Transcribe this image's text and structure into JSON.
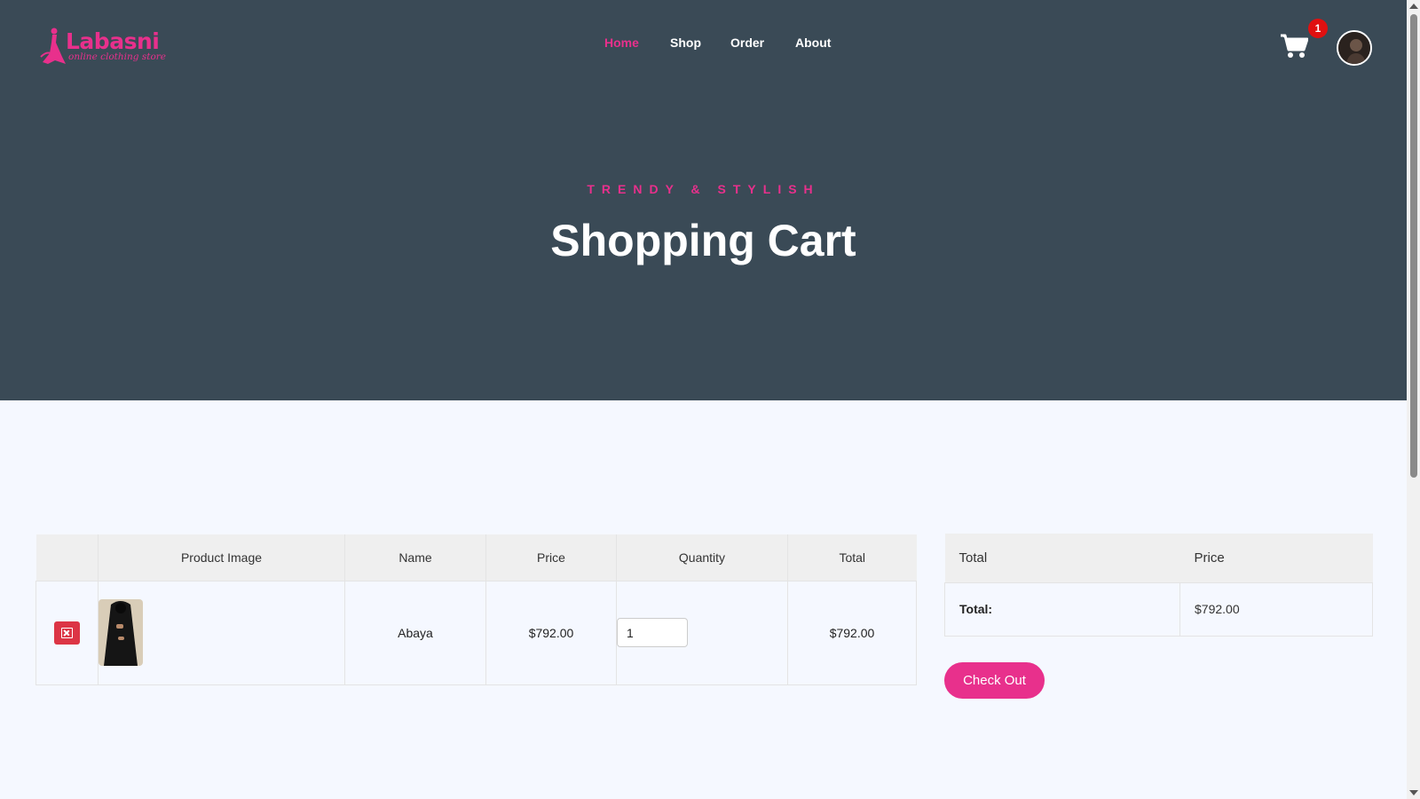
{
  "brand": {
    "name": "Labasni",
    "tagline": "online clothing store"
  },
  "nav": [
    {
      "label": "Home",
      "active": true
    },
    {
      "label": "Shop",
      "active": false
    },
    {
      "label": "Order",
      "active": false
    },
    {
      "label": "About",
      "active": false
    }
  ],
  "cart_badge": "1",
  "hero": {
    "subtitle": "TRENDY & STYLISH",
    "title": "Shopping Cart"
  },
  "cart_table": {
    "headers": [
      "",
      "Product Image",
      "Name",
      "Price",
      "Quantity",
      "Total"
    ],
    "rows": [
      {
        "name": "Abaya",
        "price": "$792.00",
        "quantity": "1",
        "total": "$792.00"
      }
    ]
  },
  "summary": {
    "headers": [
      "Total",
      "Price"
    ],
    "label": "Total:",
    "value": "$792.00"
  },
  "checkout_label": "Check Out",
  "colors": {
    "accent": "#e8308c",
    "hero_bg": "#3a4a56",
    "delete": "#dc3545",
    "badge": "#e01010"
  }
}
